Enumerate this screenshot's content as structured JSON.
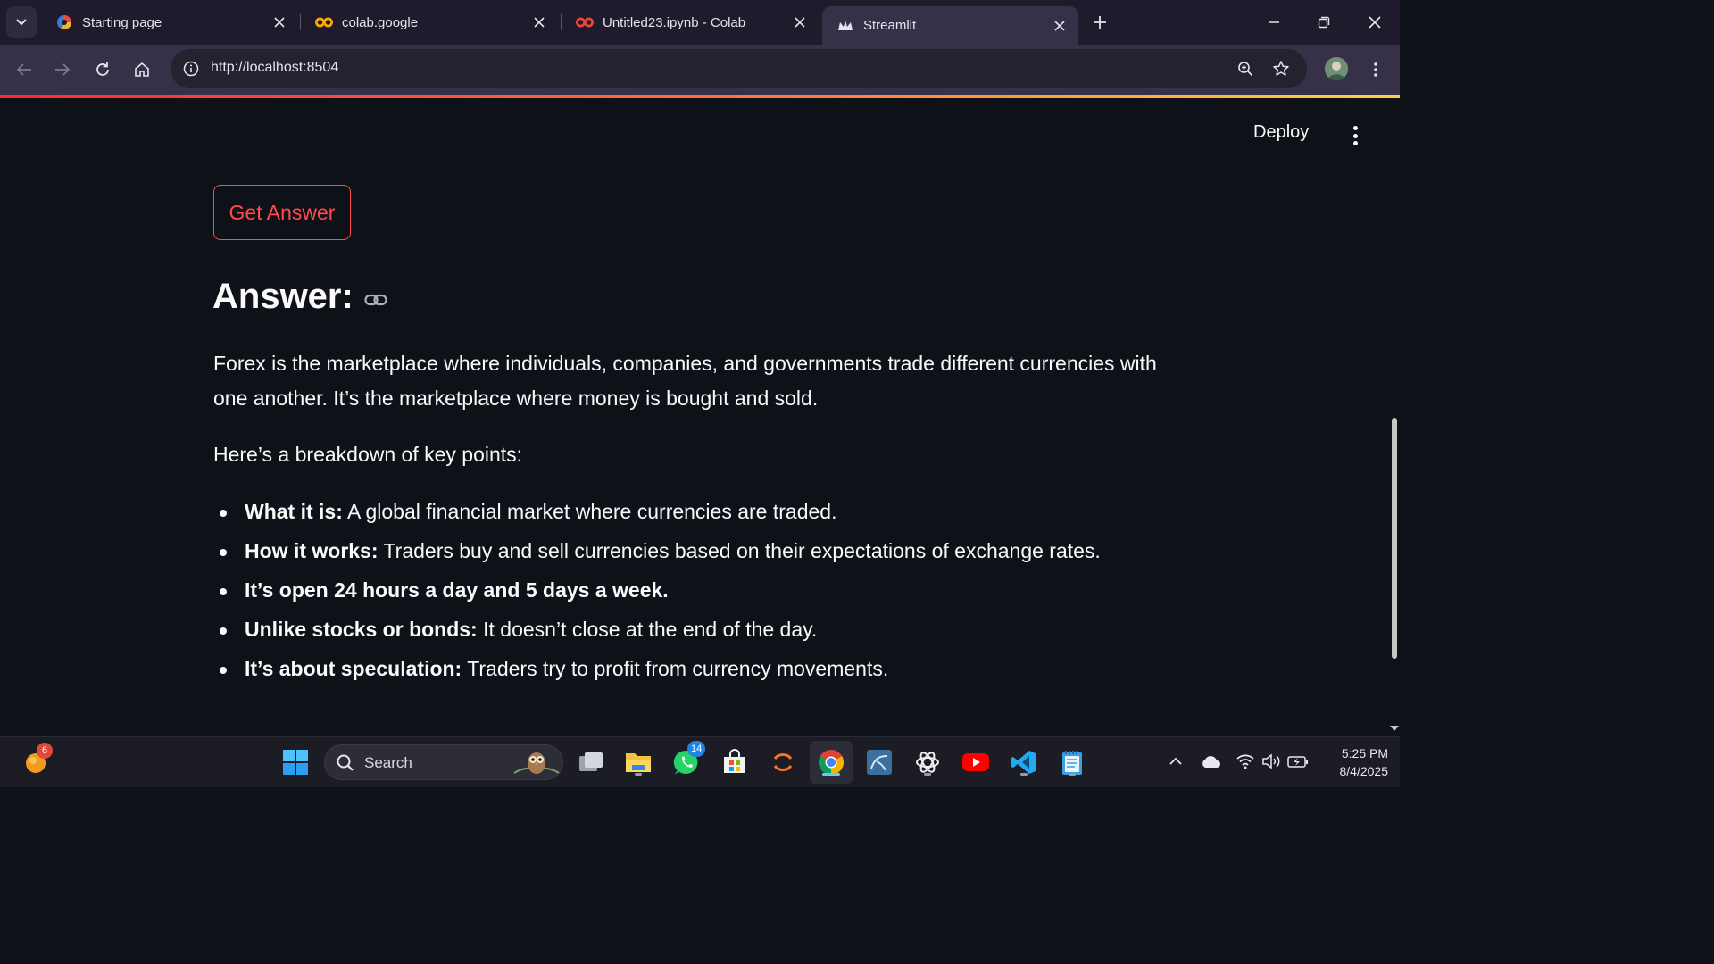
{
  "browser": {
    "tabs": [
      {
        "title": "Starting page",
        "favicon": "startpage-icon"
      },
      {
        "title": "colab.google",
        "favicon": "colab-icon"
      },
      {
        "title": "Untitled23.ipynb - Colab",
        "favicon": "colab-icon"
      },
      {
        "title": "Streamlit",
        "favicon": "streamlit-icon",
        "active": true
      }
    ],
    "url": "http://localhost:8504"
  },
  "app": {
    "header": {
      "deploy_label": "Deploy"
    },
    "button": {
      "label": "Get Answer"
    },
    "answer_heading": "Answer:",
    "paragraphs": [
      "Forex is the marketplace where individuals, companies, and governments trade different currencies with one another. It’s the marketplace where money is bought and sold.",
      "Here’s a breakdown of key points:"
    ],
    "bullets": [
      {
        "bold": "What it is:",
        "text": " A global financial market where currencies are traded."
      },
      {
        "bold": "How it works:",
        "text": " Traders buy and sell currencies based on their expectations of exchange rates."
      },
      {
        "bold": "It’s open 24 hours a day and 5 days a week.",
        "text": ""
      },
      {
        "bold": "Unlike stocks or bonds:",
        "text": " It doesn’t close at the end of the day."
      },
      {
        "bold": "It’s about speculation:",
        "text": " Traders try to profit from currency movements."
      }
    ],
    "colors": {
      "accent": "#ff4b4b",
      "background": "#0e1117",
      "text": "#fafafa"
    }
  },
  "taskbar": {
    "search_label": "Search",
    "notification_badge": "6",
    "whatsapp_badge": "14",
    "time": "5:25 PM",
    "date": "8/4/2025"
  }
}
